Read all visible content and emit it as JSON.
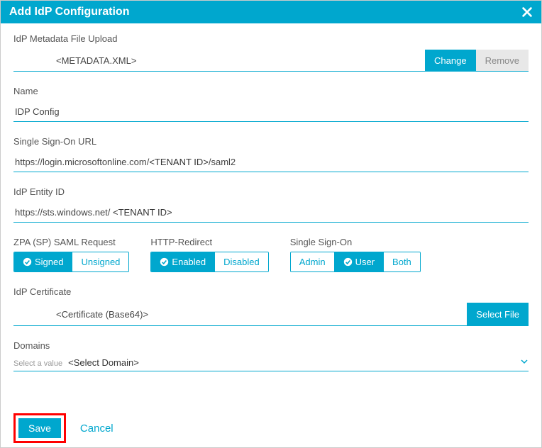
{
  "dialog": {
    "title": "Add IdP Configuration"
  },
  "metadata": {
    "label": "IdP Metadata File Upload",
    "value": "<METADATA.XML>",
    "change_label": "Change",
    "remove_label": "Remove"
  },
  "name": {
    "label": "Name",
    "value": "IDP Config"
  },
  "sso_url": {
    "label": "Single Sign-On URL",
    "prefix": "https://login.microsoftonline.com/",
    "placeholder": "<TENANT ID>",
    "suffix": "/saml2"
  },
  "entity_id": {
    "label": "IdP Entity ID",
    "prefix": "https://sts.windows.net/ ",
    "placeholder": "<TENANT ID>"
  },
  "toggles": {
    "saml_request": {
      "label": "ZPA (SP) SAML Request",
      "options": [
        "Signed",
        "Unsigned"
      ],
      "selected_index": 0
    },
    "http_redirect": {
      "label": "HTTP-Redirect",
      "options": [
        "Enabled",
        "Disabled"
      ],
      "selected_index": 0
    },
    "sso": {
      "label": "Single Sign-On",
      "options": [
        "Admin",
        "User",
        "Both"
      ],
      "selected_index": 1
    }
  },
  "cert": {
    "label": "IdP Certificate",
    "value": "<Certificate (Base64)>",
    "select_file_label": "Select File"
  },
  "domains": {
    "label": "Domains",
    "helper": "Select a value",
    "value": "<Select Domain>"
  },
  "footer": {
    "save_label": "Save",
    "cancel_label": "Cancel"
  }
}
